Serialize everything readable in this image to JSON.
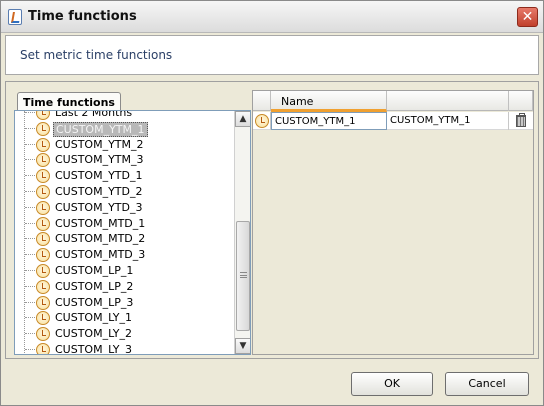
{
  "window": {
    "title": "Time functions"
  },
  "header": {
    "text": "Set metric time functions"
  },
  "tree_panel": {
    "tab_label": "Time functions",
    "items": [
      {
        "label": "Last 2 Months",
        "selected": false
      },
      {
        "label": "CUSTOM_YTM_1",
        "selected": true
      },
      {
        "label": "CUSTOM_YTM_2",
        "selected": false
      },
      {
        "label": "CUSTOM_YTM_3",
        "selected": false
      },
      {
        "label": "CUSTOM_YTD_1",
        "selected": false
      },
      {
        "label": "CUSTOM_YTD_2",
        "selected": false
      },
      {
        "label": "CUSTOM_YTD_3",
        "selected": false
      },
      {
        "label": "CUSTOM_MTD_1",
        "selected": false
      },
      {
        "label": "CUSTOM_MTD_2",
        "selected": false
      },
      {
        "label": "CUSTOM_MTD_3",
        "selected": false
      },
      {
        "label": "CUSTOM_LP_1",
        "selected": false
      },
      {
        "label": "CUSTOM_LP_2",
        "selected": false
      },
      {
        "label": "CUSTOM_LP_3",
        "selected": false
      },
      {
        "label": "CUSTOM_LY_1",
        "selected": false
      },
      {
        "label": "CUSTOM_LY_2",
        "selected": false
      },
      {
        "label": "CUSTOM_LY_3",
        "selected": false
      }
    ]
  },
  "table": {
    "columns": [
      "",
      "Name",
      "",
      ""
    ],
    "rows": [
      {
        "name": "CUSTOM_YTM_1",
        "value": "CUSTOM_YTM_1"
      }
    ]
  },
  "buttons": {
    "ok_label": "OK",
    "cancel_label": "Cancel"
  },
  "icons": {
    "window_icon": "java-cup-icon",
    "item_icon": "clock-icon",
    "delete_icon": "trash-icon",
    "close_icon": "close-icon"
  },
  "colors": {
    "header_text": "#2a3f66",
    "selected_item_bg": "#b8b8b8",
    "sort_column_accent": "#f0a030",
    "close_button": "#c0402c"
  }
}
